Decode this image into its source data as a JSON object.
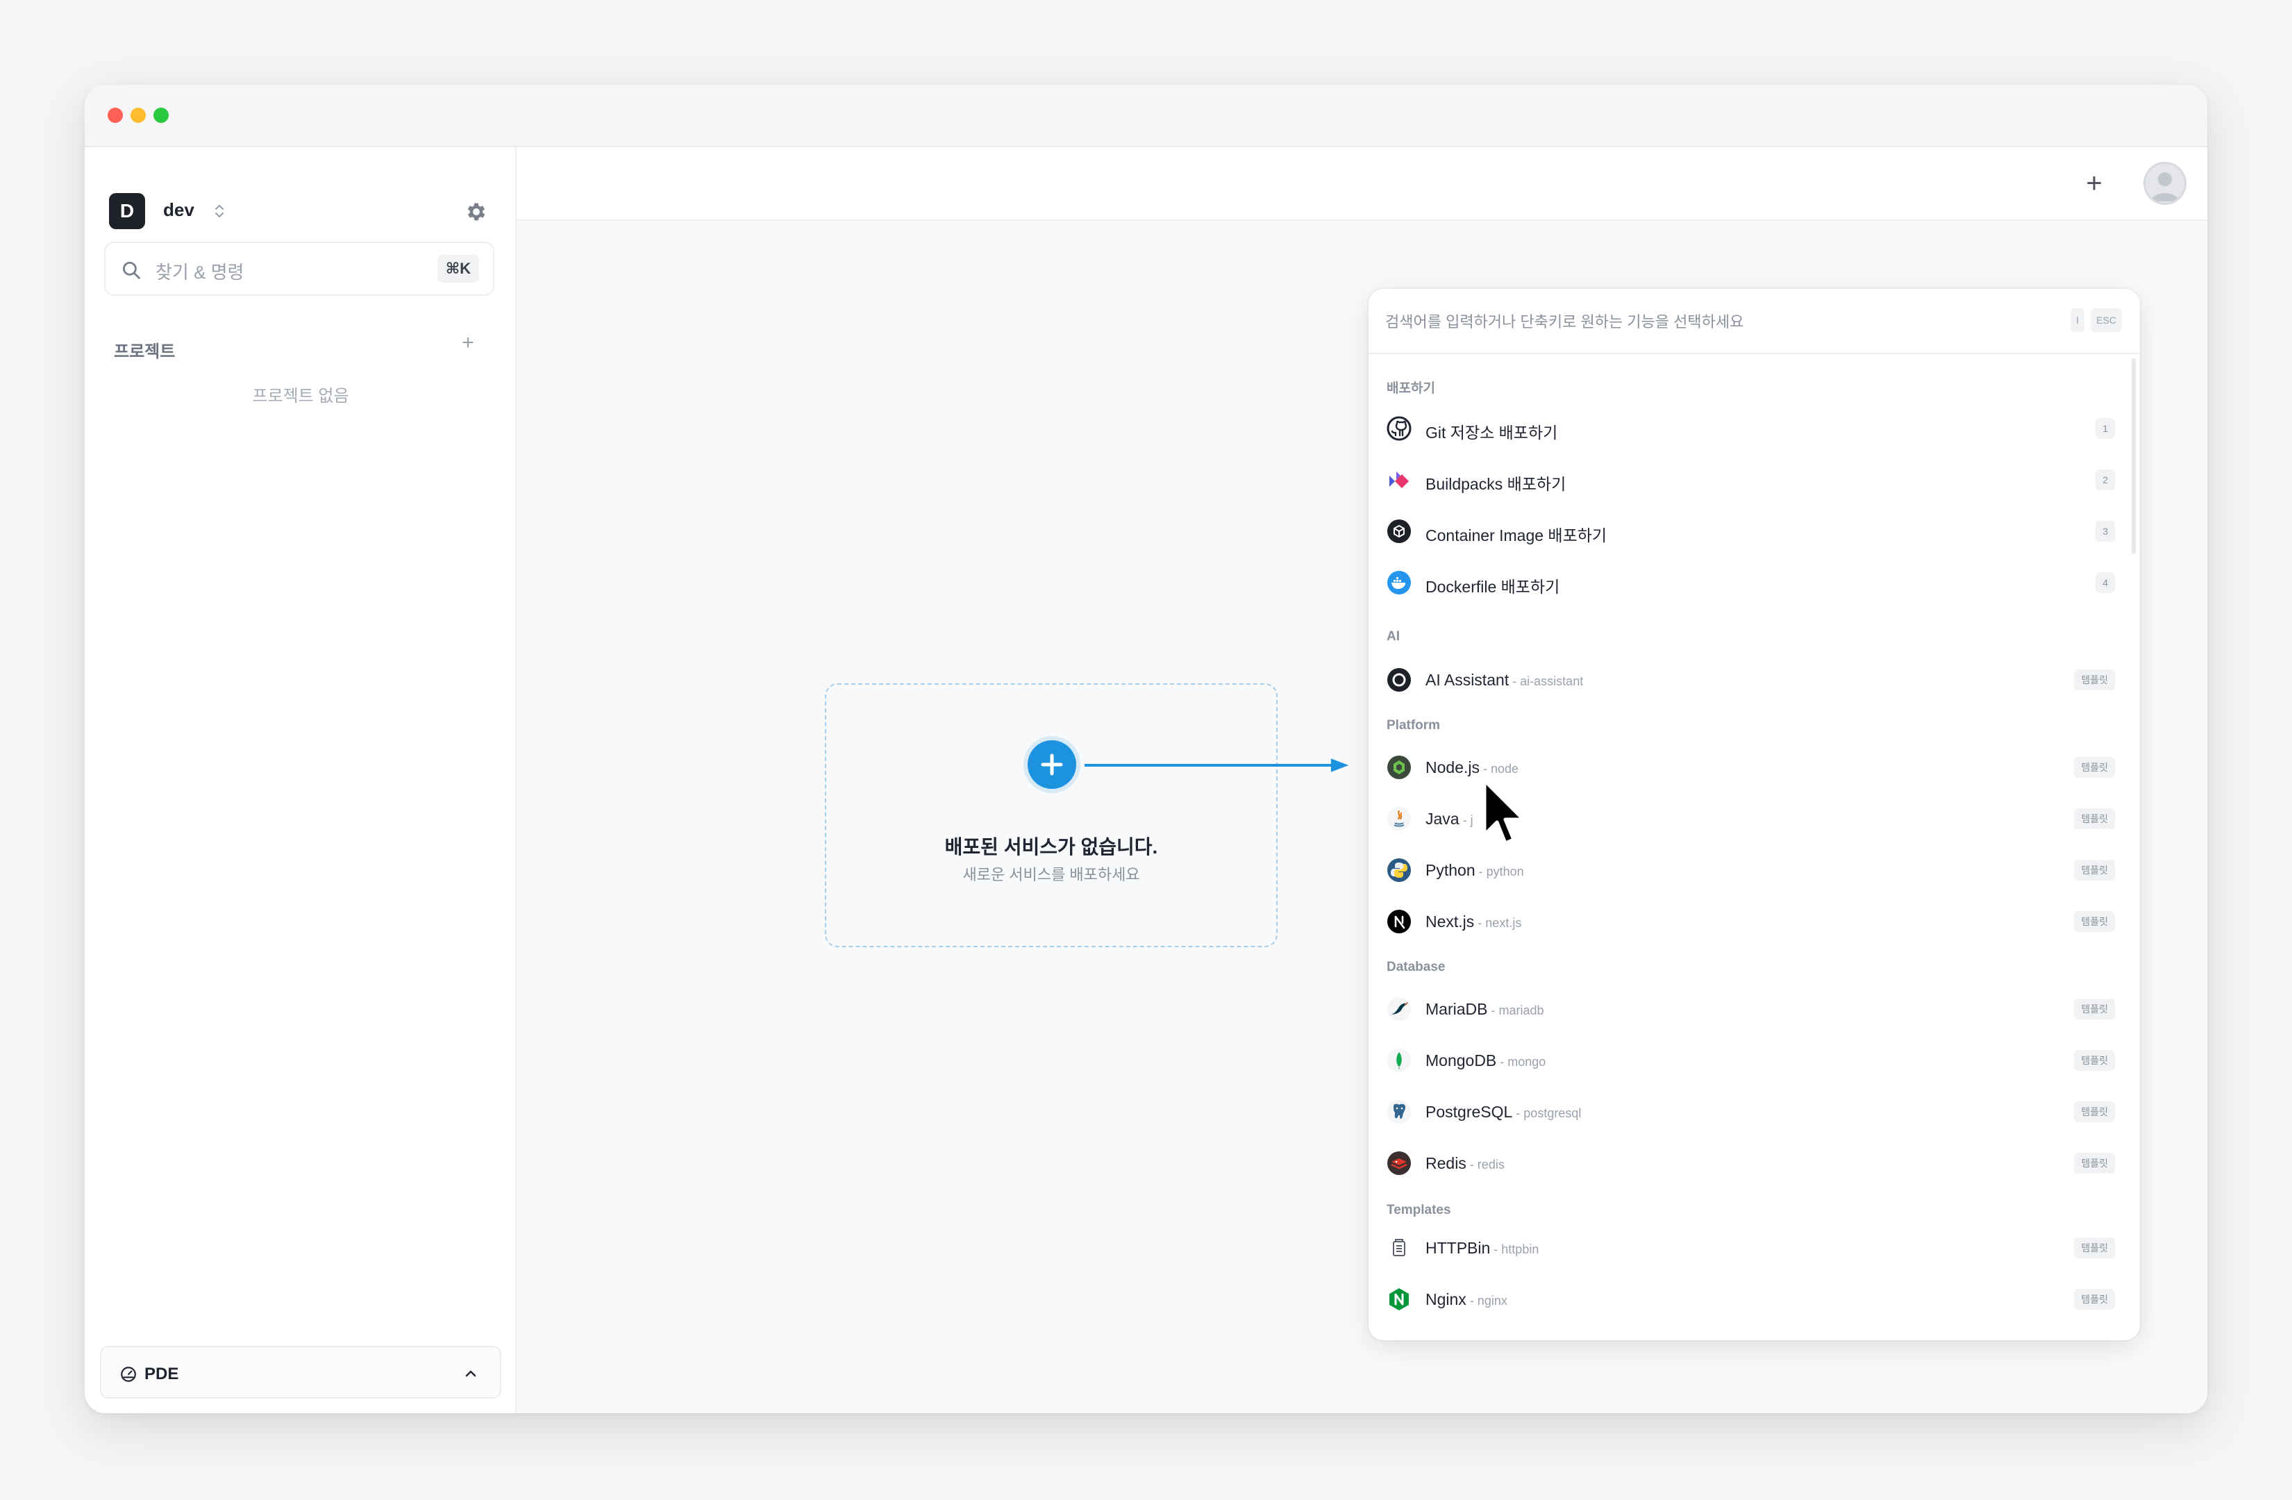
{
  "sidebar": {
    "workspace_initial": "D",
    "workspace_name": "dev",
    "search_placeholder": "찾기 & 명령",
    "search_shortcut": "⌘K",
    "projects_label": "프로젝트",
    "projects_empty": "프로젝트 없음",
    "footer_label": "PDE"
  },
  "main": {
    "empty_title": "배포된 서비스가 없습니다.",
    "empty_subtitle": "새로운 서비스를 배포하세요"
  },
  "palette": {
    "placeholder": "검색어를 입력하거나 단축키로 원하는 기능을 선택하세요",
    "kbd_1": "I",
    "kbd_2": "ESC",
    "sections": {
      "deploy": "배포하기",
      "ai": "AI",
      "platform": "Platform",
      "database": "Database",
      "templates": "Templates"
    },
    "deploy_items": [
      {
        "label": "Git 저장소 배포하기",
        "badge": "1",
        "icon": "github-icon"
      },
      {
        "label": "Buildpacks 배포하기",
        "badge": "2",
        "icon": "buildpacks-icon"
      },
      {
        "label": "Container Image 배포하기",
        "badge": "3",
        "icon": "container-icon"
      },
      {
        "label": "Dockerfile 배포하기",
        "badge": "4",
        "icon": "docker-icon"
      }
    ],
    "ai_items": [
      {
        "label": "AI Assistant",
        "alias": " - ai-assistant",
        "badge": "템플릿",
        "icon": "openai-icon"
      }
    ],
    "platform_items": [
      {
        "label": "Node.js",
        "alias": " - node",
        "badge": "템플릿",
        "icon": "nodejs-icon"
      },
      {
        "label": "Java",
        "alias": " - j",
        "badge": "템플릿",
        "icon": "java-icon"
      },
      {
        "label": "Python",
        "alias": " - python",
        "badge": "템플릿",
        "icon": "python-icon"
      },
      {
        "label": "Next.js",
        "alias": " - next.js",
        "badge": "템플릿",
        "icon": "nextjs-icon"
      }
    ],
    "database_items": [
      {
        "label": "MariaDB",
        "alias": " - mariadb",
        "badge": "템플릿",
        "icon": "mariadb-icon"
      },
      {
        "label": "MongoDB",
        "alias": " - mongo",
        "badge": "템플릿",
        "icon": "mongodb-icon"
      },
      {
        "label": "PostgreSQL",
        "alias": " - postgresql",
        "badge": "템플릿",
        "icon": "postgresql-icon"
      },
      {
        "label": "Redis",
        "alias": " - redis",
        "badge": "템플릿",
        "icon": "redis-icon"
      }
    ],
    "template_items": [
      {
        "label": "HTTPBin",
        "alias": " - httpbin",
        "badge": "템플릿",
        "icon": "httpbin-icon"
      },
      {
        "label": "Nginx",
        "alias": " - nginx",
        "badge": "템플릿",
        "icon": "nginx-icon"
      }
    ]
  }
}
